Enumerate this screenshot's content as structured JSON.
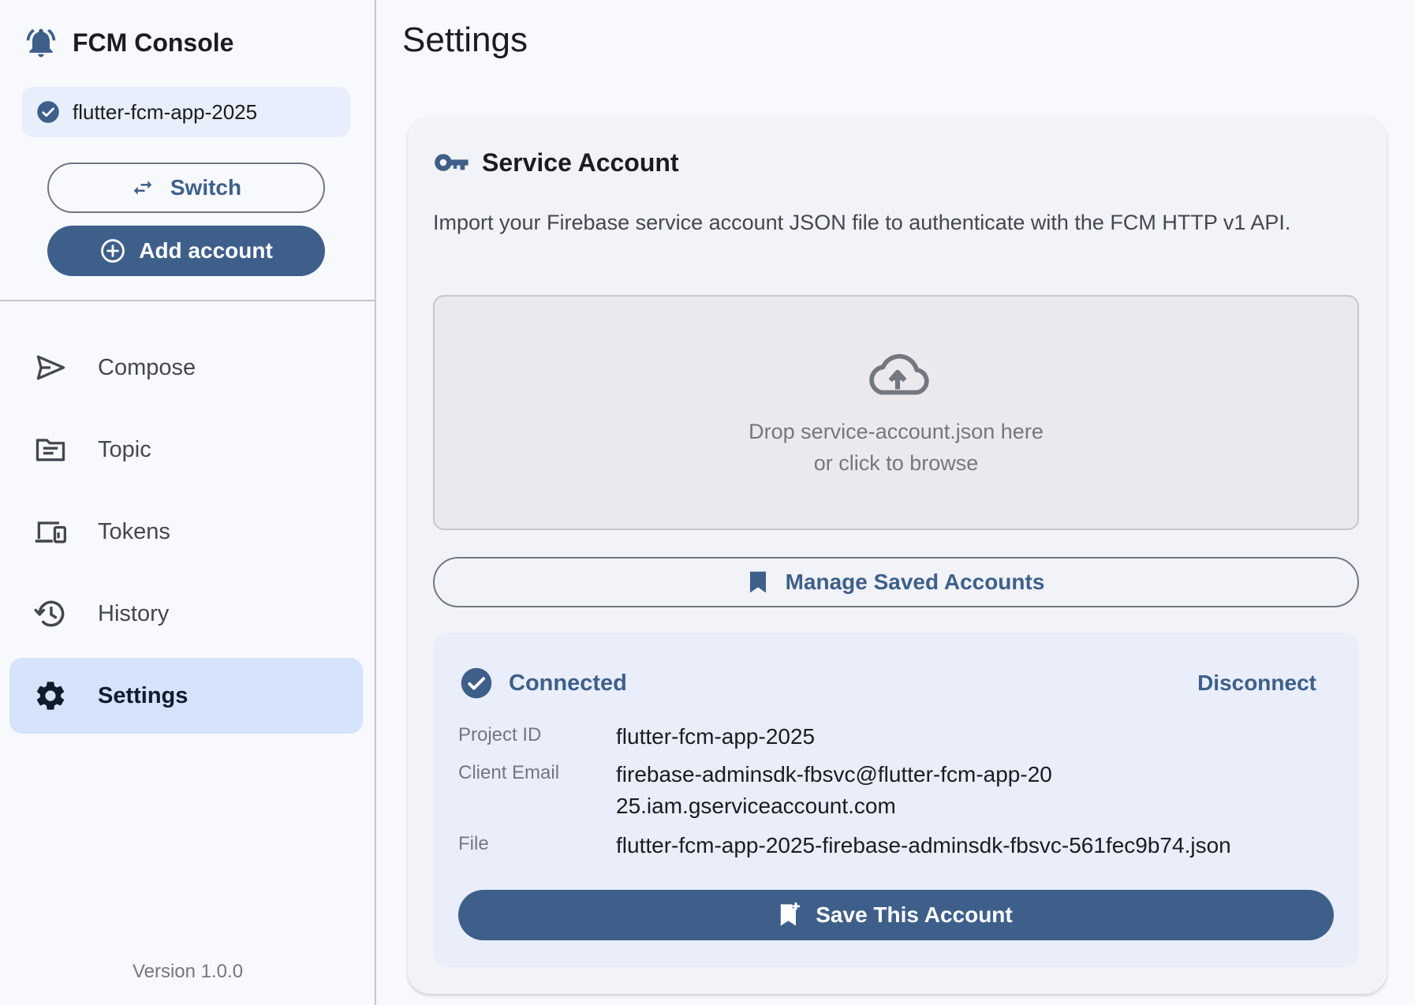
{
  "app": {
    "title": "FCM Console",
    "version": "Version 1.0.0",
    "colors": {
      "primary": "#3e5f8a",
      "active_nav": "#d5e3fc",
      "surface": "#f8f9fd"
    }
  },
  "sidebar": {
    "project": "flutter-fcm-app-2025",
    "switch_label": "Switch",
    "add_account_label": "Add account",
    "items": [
      {
        "label": "Compose",
        "icon": "send-icon"
      },
      {
        "label": "Topic",
        "icon": "topic-icon"
      },
      {
        "label": "Tokens",
        "icon": "devices-icon"
      },
      {
        "label": "History",
        "icon": "history-icon"
      },
      {
        "label": "Settings",
        "icon": "gear-icon",
        "active": true
      }
    ]
  },
  "main": {
    "title": "Settings",
    "card": {
      "title": "Service Account",
      "description": "Import your Firebase service account JSON file to authenticate with the FCM HTTP v1 API.",
      "dropzone": {
        "line1": "Drop service-account.json here",
        "line2": "or click to browse"
      },
      "manage_label": "Manage Saved Accounts",
      "connection": {
        "status": "Connected",
        "disconnect_label": "Disconnect",
        "fields": [
          {
            "label": "Project ID",
            "value": "flutter-fcm-app-2025"
          },
          {
            "label": "Client Email",
            "value": "firebase-adminsdk-fbsvc@flutter-fcm-app-2025.iam.gserviceaccount.com"
          },
          {
            "label": "File",
            "value": "flutter-fcm-app-2025-firebase-adminsdk-fbsvc-561fec9b74.json"
          }
        ],
        "save_label": "Save This Account"
      }
    }
  }
}
